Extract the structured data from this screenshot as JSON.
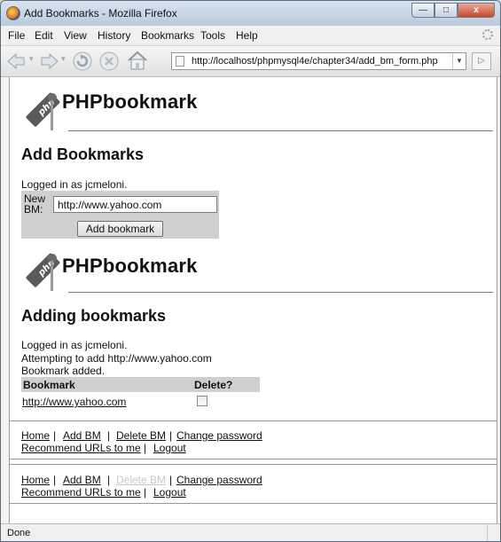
{
  "window": {
    "title": "Add Bookmarks - Mozilla Firefox",
    "controls": {
      "minimize": "—",
      "maximize": "□",
      "close": "x"
    }
  },
  "menu": [
    "File",
    "Edit",
    "View",
    "History",
    "Bookmarks",
    "Tools",
    "Help"
  ],
  "nav": {
    "url": "http://localhost/phpmysql4e/chapter34/add_bm_form.php"
  },
  "status": "Done",
  "section1": {
    "logo_text": "php",
    "brand": "PHPbookmark",
    "heading": "Add Bookmarks",
    "logged_in": "Logged in as jcmeloni.",
    "form": {
      "label_line1": "New",
      "label_line2": "BM:",
      "value": "http://www.yahoo.com",
      "button": "Add bookmark"
    }
  },
  "section2": {
    "logo_text": "php",
    "brand": "PHPbookmark",
    "heading": "Adding bookmarks",
    "messages": [
      "Logged in as jcmeloni.",
      "Attempting to add http://www.yahoo.com",
      "Bookmark added."
    ],
    "table": {
      "headers": [
        "Bookmark",
        "Delete?"
      ],
      "rows": [
        {
          "bookmark": "http://www.yahoo.com",
          "delete": false
        }
      ]
    }
  },
  "menus_lower": {
    "first": {
      "links": [
        "Home",
        "Add BM",
        "Delete BM",
        "Change password"
      ],
      "links2": [
        "Recommend URLs to me",
        "Logout"
      ]
    },
    "second": {
      "links": [
        "Home",
        "Add BM",
        "Delete BM",
        "Change password"
      ],
      "links2": [
        "Recommend URLs to me",
        "Logout"
      ]
    }
  },
  "colors": {
    "title_gradient_top": "#d8e4f0",
    "form_bg": "#cfcfcf",
    "close_red": "#c9462c"
  },
  "icons": [
    "firefox-icon",
    "back-arrow-icon",
    "forward-arrow-icon",
    "reload-icon",
    "stop-icon",
    "home-icon",
    "page-icon",
    "go-icon"
  ]
}
